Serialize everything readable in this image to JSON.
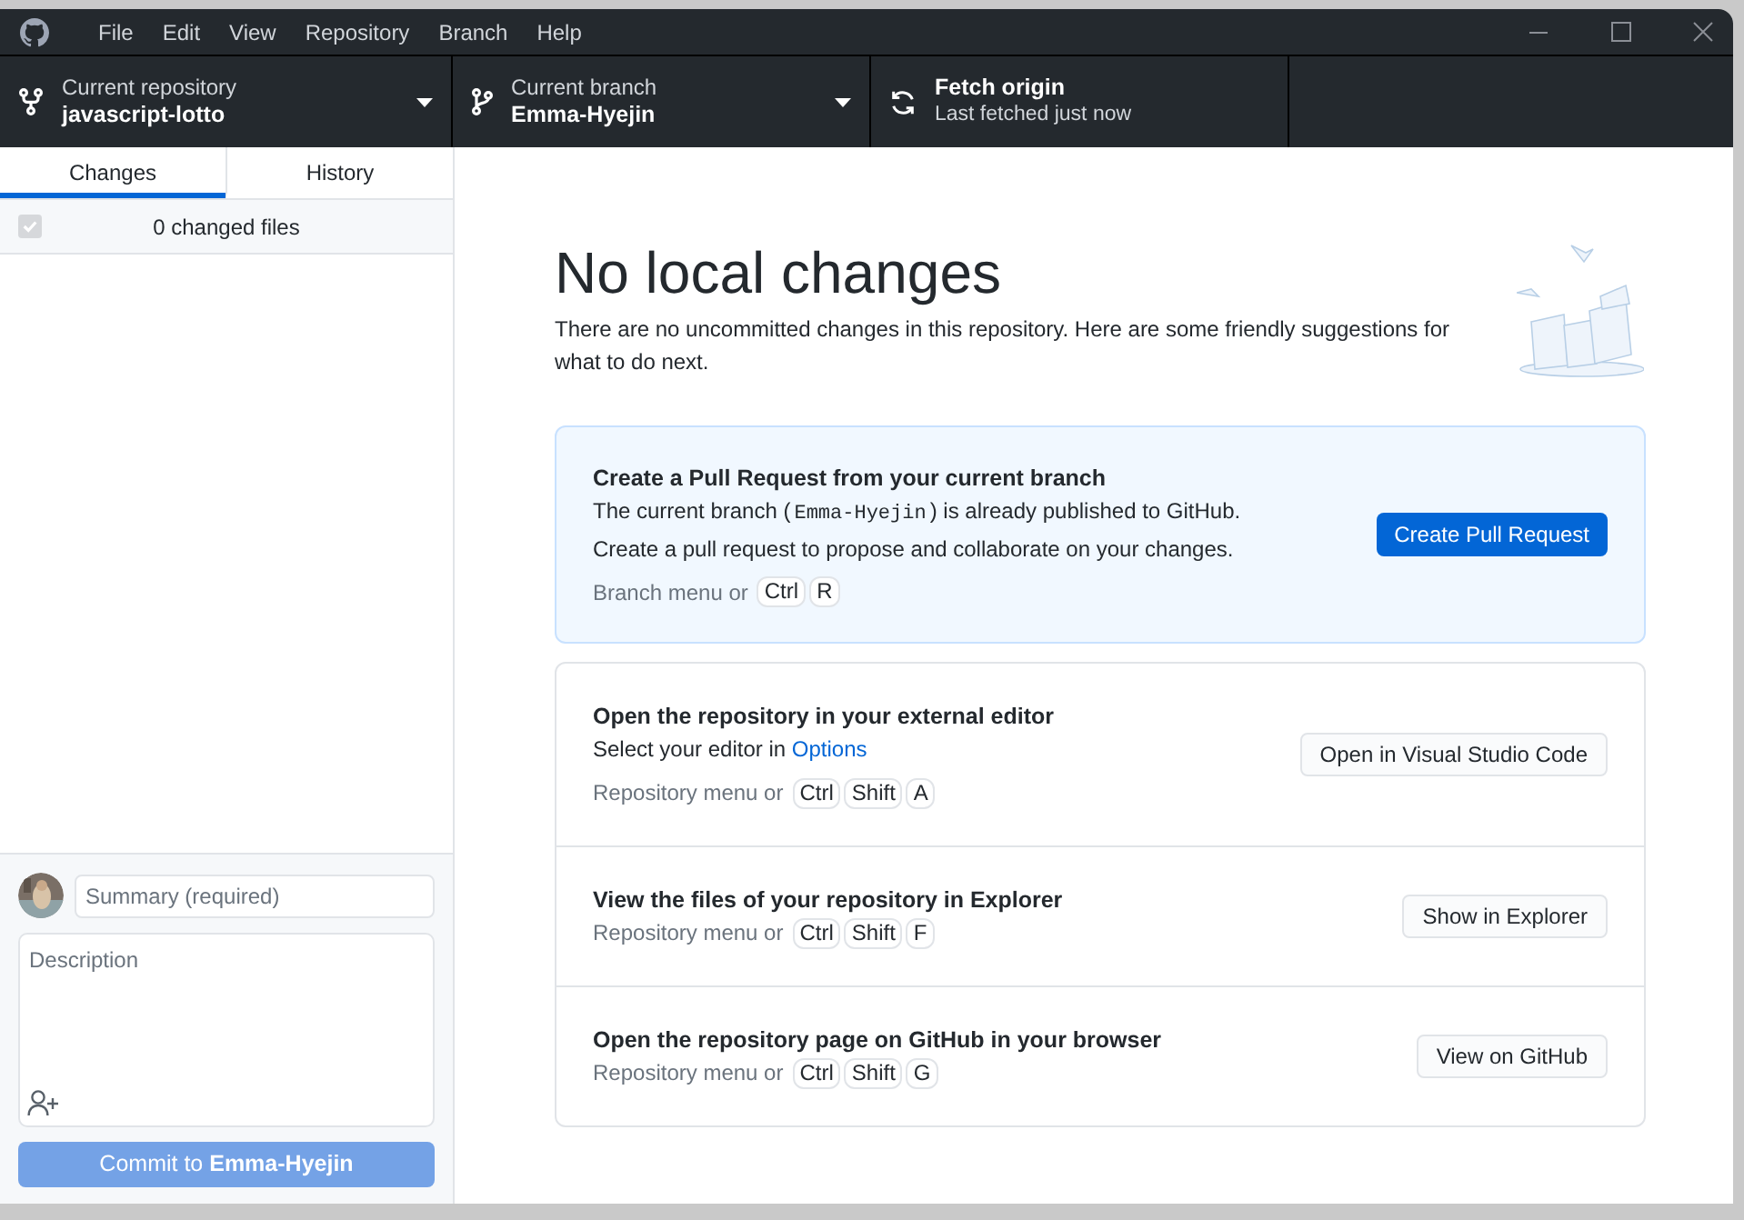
{
  "title_bar": {
    "menu": [
      "File",
      "Edit",
      "View",
      "Repository",
      "Branch",
      "Help"
    ]
  },
  "toolbar": {
    "repository": {
      "label": "Current repository",
      "value": "javascript-lotto"
    },
    "branch": {
      "label": "Current branch",
      "value": "Emma-Hyejin"
    },
    "fetch": {
      "title": "Fetch origin",
      "subtitle": "Last fetched just now"
    }
  },
  "sidebar": {
    "tabs": [
      {
        "label": "Changes",
        "selected": true
      },
      {
        "label": "History",
        "selected": false
      }
    ],
    "select_all": {
      "checked": true,
      "disabled": true
    },
    "changed_files": "0 changed files",
    "commit": {
      "summary_placeholder": "Summary (required)",
      "description_placeholder": "Description",
      "button": "Commit to **Emma-Hyejin**",
      "disabled": true
    }
  },
  "main": {
    "heading": "No local changes",
    "intro": "There are no uncommitted changes in this repository. Here are some friendly suggestions for what to do next.",
    "suggestions": [
      {
        "kind": "primary",
        "title": "Create a Pull Request from your current branch",
        "description": [
          {
            "kind": "text",
            "text": "The current branch ("
          },
          {
            "kind": "code",
            "text": "Emma-Hyejin"
          },
          {
            "kind": "text",
            "text": ") is already published to GitHub. Create a pull request to propose and collaborate on your changes."
          }
        ],
        "shortcut_prefix": "Branch menu or",
        "keys": [
          "Ctrl",
          "R"
        ],
        "button": "Create Pull Request"
      },
      {
        "kind": "secondary",
        "title": "Open the repository in your external editor",
        "description": [
          {
            "kind": "text",
            "text": "Select your editor in "
          },
          {
            "kind": "link",
            "text": "Options"
          }
        ],
        "shortcut_prefix": "Repository menu or",
        "keys": [
          "Ctrl",
          "Shift",
          "A"
        ],
        "button": "Open in Visual Studio Code"
      },
      {
        "kind": "secondary",
        "title": "View the files of your repository in Explorer",
        "shortcut_prefix": "Repository menu or",
        "keys": [
          "Ctrl",
          "Shift",
          "F"
        ],
        "button": "Show in Explorer"
      },
      {
        "kind": "secondary",
        "title": "Open the repository page on GitHub in your browser",
        "shortcut_prefix": "Repository menu or",
        "keys": [
          "Ctrl",
          "Shift",
          "G"
        ],
        "button": "View on GitHub"
      }
    ]
  }
}
